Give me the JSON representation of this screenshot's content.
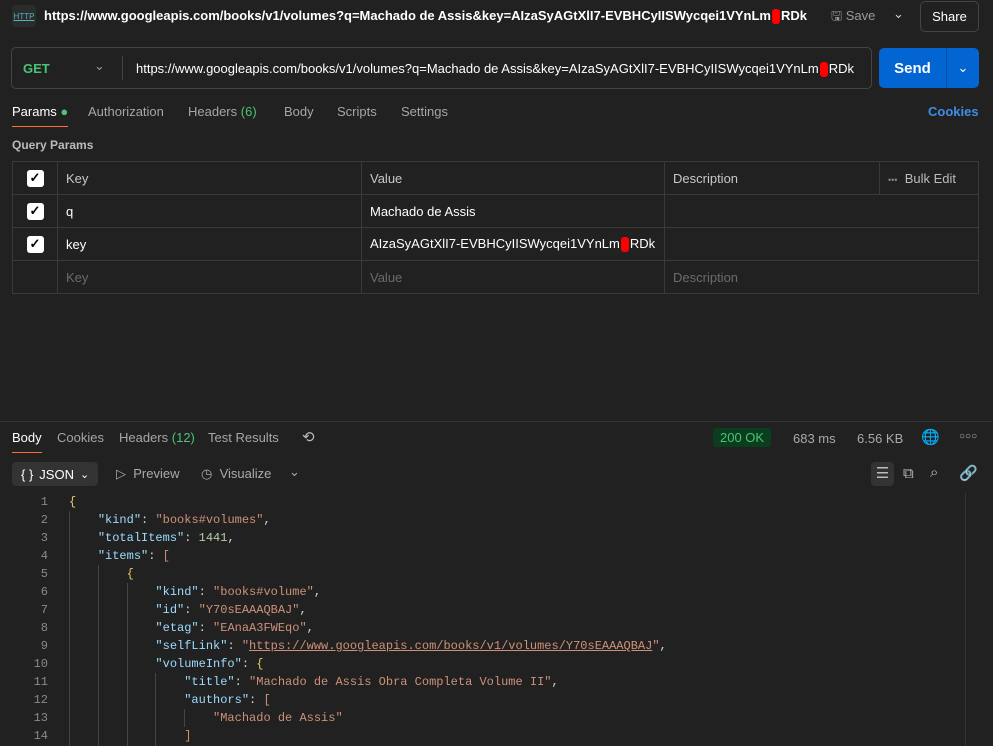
{
  "header": {
    "icon": "http-icon",
    "title_before": "https://www.googleapis.com/books/v1/volumes?q=Machado de Assis&key=AIzaSyAGtXlI7-EVBHCyIISWycqei1VYnLm",
    "title_after": "RDk",
    "save_label": "Save",
    "share_label": "Share"
  },
  "request": {
    "method": "GET",
    "url_before": "https://www.googleapis.com/books/v1/volumes?q=Machado de Assis&key=AIzaSyAGtXlI7-EVBHCyIISWycqei1VYnLm",
    "url_after": "RDk",
    "send_label": "Send"
  },
  "tabs": [
    {
      "label": "Params"
    },
    {
      "label": "Authorization"
    },
    {
      "label": "Headers",
      "count": "(6)"
    },
    {
      "label": "Body"
    },
    {
      "label": "Scripts"
    },
    {
      "label": "Settings"
    }
  ],
  "cookies_label": "Cookies",
  "query_params": {
    "title": "Query Params",
    "headers": [
      "Key",
      "Value",
      "Description"
    ],
    "bulk_edit": "Bulk Edit",
    "rows": [
      {
        "key": "q",
        "value": "Machado de Assis"
      },
      {
        "key": "key",
        "value_before": "AIzaSyAGtXlI7-EVBHCyIISWycqei1VYnLm",
        "value_after": "RDk"
      }
    ],
    "placeholders": {
      "key": "Key",
      "value": "Value",
      "description": "Description"
    }
  },
  "response": {
    "tabs": [
      {
        "label": "Body"
      },
      {
        "label": "Cookies"
      },
      {
        "label": "Headers",
        "count": "(12)"
      },
      {
        "label": "Test Results"
      }
    ],
    "status": "200 OK",
    "time": "683 ms",
    "size": "6.56 KB",
    "format": "JSON",
    "preview": "Preview",
    "visualize": "Visualize"
  },
  "colors": {
    "accent": "#0265d2",
    "status_ok": "#4bc375",
    "tab_underline": "#ff6c37"
  },
  "code_lines": [
    [
      [
        "b",
        "{"
      ]
    ],
    [
      [
        "p",
        "    "
      ],
      [
        "k",
        "\"kind\""
      ],
      [
        "p",
        ": "
      ],
      [
        "s",
        "\"books#volumes\""
      ],
      [
        "p",
        ","
      ]
    ],
    [
      [
        "p",
        "    "
      ],
      [
        "k",
        "\"totalItems\""
      ],
      [
        "p",
        ": "
      ],
      [
        "n",
        "1441"
      ],
      [
        "p",
        ","
      ]
    ],
    [
      [
        "p",
        "    "
      ],
      [
        "k",
        "\"items\""
      ],
      [
        "p",
        ": "
      ],
      [
        "s",
        "["
      ]
    ],
    [
      [
        "p",
        "        "
      ],
      [
        "b",
        "{"
      ]
    ],
    [
      [
        "p",
        "            "
      ],
      [
        "k",
        "\"kind\""
      ],
      [
        "p",
        ": "
      ],
      [
        "s",
        "\"books#volume\""
      ],
      [
        "p",
        ","
      ]
    ],
    [
      [
        "p",
        "            "
      ],
      [
        "k",
        "\"id\""
      ],
      [
        "p",
        ": "
      ],
      [
        "s",
        "\"Y70sEAAAQBAJ\""
      ],
      [
        "p",
        ","
      ]
    ],
    [
      [
        "p",
        "            "
      ],
      [
        "k",
        "\"etag\""
      ],
      [
        "p",
        ": "
      ],
      [
        "s",
        "\"EAnaA3FWEqo\""
      ],
      [
        "p",
        ","
      ]
    ],
    [
      [
        "p",
        "            "
      ],
      [
        "k",
        "\"selfLink\""
      ],
      [
        "p",
        ": "
      ],
      [
        "s",
        "\""
      ],
      [
        "lnk",
        "https://www.googleapis.com/books/v1/volumes/Y70sEAAAQBAJ"
      ],
      [
        "s",
        "\""
      ],
      [
        "p",
        ","
      ]
    ],
    [
      [
        "p",
        "            "
      ],
      [
        "k",
        "\"volumeInfo\""
      ],
      [
        "p",
        ": "
      ],
      [
        "b",
        "{"
      ]
    ],
    [
      [
        "p",
        "                "
      ],
      [
        "k",
        "\"title\""
      ],
      [
        "p",
        ": "
      ],
      [
        "s",
        "\"Machado de Assis Obra Completa Volume II\""
      ],
      [
        "p",
        ","
      ]
    ],
    [
      [
        "p",
        "                "
      ],
      [
        "k",
        "\"authors\""
      ],
      [
        "p",
        ": "
      ],
      [
        "s",
        "["
      ]
    ],
    [
      [
        "p",
        "                    "
      ],
      [
        "s",
        "\"Machado de Assis\""
      ]
    ],
    [
      [
        "p",
        "                "
      ],
      [
        "s",
        "]"
      ]
    ]
  ]
}
